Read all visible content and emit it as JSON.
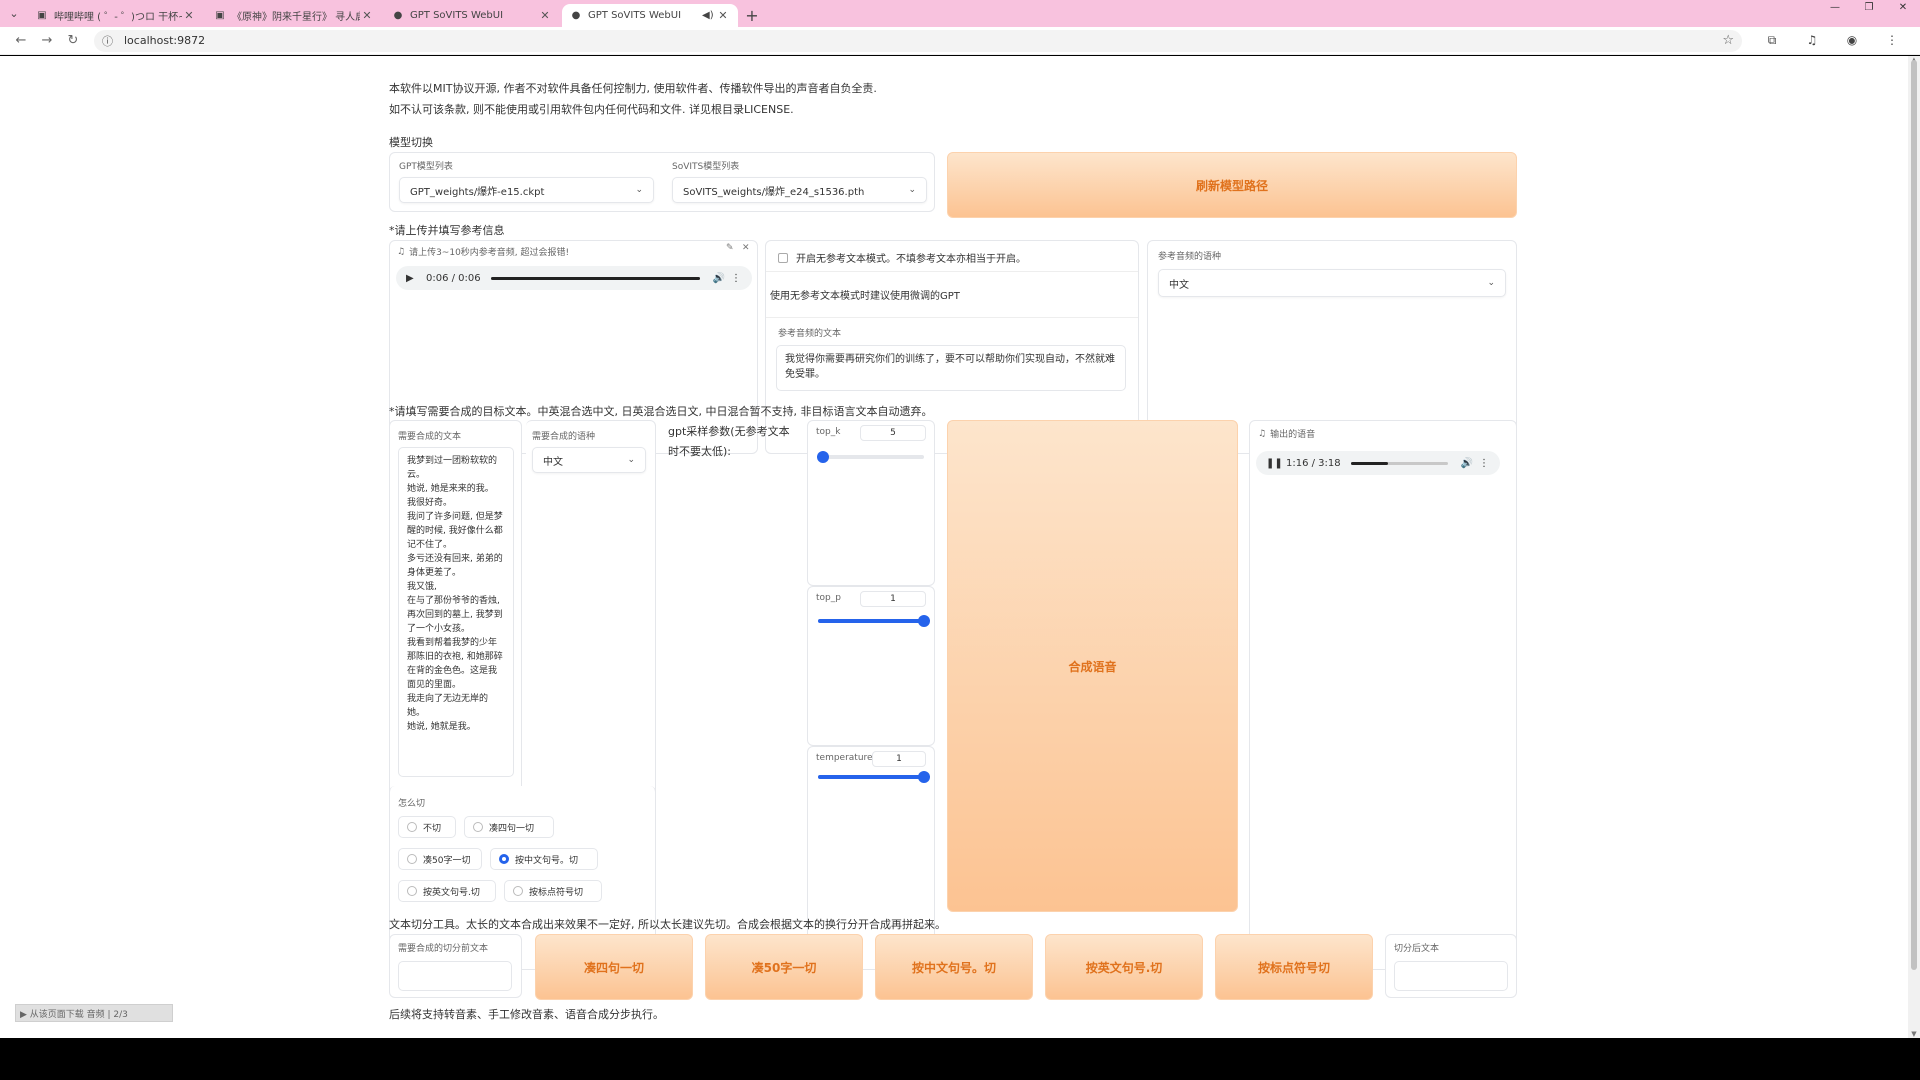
{
  "browser": {
    "tabs": [
      {
        "title": "哔哩哔哩 ( ゜- ゜)つロ 干杯~-b",
        "active": false
      },
      {
        "title": "《原神》阴来千星行》 寻人启事",
        "active": false
      },
      {
        "title": "GPT SoVITS WebUI",
        "active": false
      },
      {
        "title": "GPT SoVITS WebUI",
        "active": true
      }
    ],
    "url": "localhost:9872"
  },
  "notice": {
    "line1": "本软件以MIT协议开源, 作者不对软件具备任何控制力, 使用软件者、传播软件导出的声音者自负全责.",
    "line2": "如不认可该条款, 则不能使用或引用软件包内任何代码和文件. 详见根目录LICENSE."
  },
  "model_switch": {
    "heading": "模型切换",
    "gpt_label": "GPT模型列表",
    "gpt_value": "GPT_weights/爆炸-e15.ckpt",
    "sovits_label": "SoVITS模型列表",
    "sovits_value": "SoVITS_weights/爆炸_e24_s1536.pth",
    "refresh_label": "刷新模型路径"
  },
  "reference": {
    "heading": "*请上传并填写参考信息",
    "audio_label": "请上传3~10秒内参考音频, 超过会报错!",
    "audio_time": "0:06 / 0:06",
    "audio_progress": 1.0,
    "no_ref_label": "开启无参考文本模式。不填参考文本亦相当于开启。",
    "no_ref_hint": "使用无参考文本模式时建议使用微调的GPT",
    "ref_text_label": "参考音频的文本",
    "ref_text_value": "我觉得你需要再研究你们的训练了，要不可以帮助你们实现自动，不然就难免受罪。",
    "lang_label": "参考音频的语种",
    "lang_value": "中文"
  },
  "target": {
    "heading": "*请填写需要合成的目标文本。中英混合选中文, 日英混合选日文, 中日混合暂不支持, 非目标语言文本自动遗弃。",
    "text_label": "需要合成的文本",
    "text_value": "我梦到过一团粉软软的云。\n她说, 她是来来的我。\n我很好奇。\n我问了许多问题, 但是梦醒的时候, 我好像什么都记不住了。\n多亏还没有回来, 弟弟的身体更差了。\n我又饿,\n在与了那份爷爷的香烛, 再次回到的墓上, 我梦到了一个小女孩。\n我看到帮着我梦的少年那陈旧的衣袍, 和她那碎在背的金色色。这是我面见的里面。\n我走向了无边无岸的她。\n她说, 她就是我。",
    "lang_label": "需要合成的语种",
    "lang_value": "中文",
    "gpt_param_label": "gpt采样参数(无参考文本时不要太低):",
    "top_k_label": "top_k",
    "top_k_value": "5",
    "top_k_fraction": 0.05,
    "top_p_label": "top_p",
    "top_p_value": "1",
    "top_p_fraction": 1.0,
    "temperature_label": "temperature",
    "temperature_value": "1",
    "temperature_fraction": 1.0,
    "synth_button": "合成语音",
    "output_label": "输出的语音",
    "output_time": "1:16 / 3:18",
    "output_progress": 0.38
  },
  "cut": {
    "label": "怎么切",
    "options": [
      {
        "label": "不切",
        "checked": false
      },
      {
        "label": "凑四句一切",
        "checked": false
      },
      {
        "label": "凑50字一切",
        "checked": false
      },
      {
        "label": "按中文句号。切",
        "checked": true
      },
      {
        "label": "按英文句号.切",
        "checked": false
      },
      {
        "label": "按标点符号切",
        "checked": false
      }
    ]
  },
  "split_section": {
    "heading": "文本切分工具。太长的文本合成出来效果不一定好, 所以太长建议先切。合成会根据文本的换行分开合成再拼起来。",
    "input_label": "需要合成的切分前文本",
    "buttons": [
      "凑四句一切",
      "凑50字一切",
      "按中文句号。切",
      "按英文句号.切",
      "按标点符号切"
    ],
    "output_label": "切分后文本"
  },
  "footer_note": "后续将支持转音素、手工修改音素、语音合成分步执行。",
  "float_button": "▶ 从该页面下载 音频 | 2/3",
  "colors": {
    "accent": "#2563eb",
    "orange_text": "#e0721d",
    "orange_light": "#fde5cc",
    "orange_dark": "#fcc392",
    "tabbar": "#f8c2de"
  }
}
